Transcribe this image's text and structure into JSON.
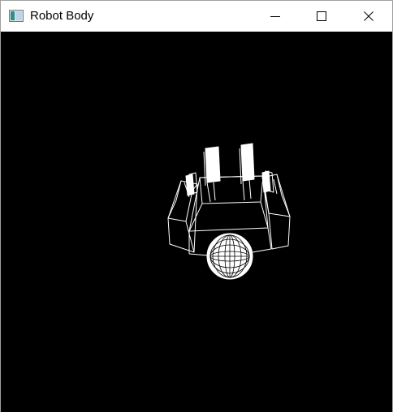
{
  "window": {
    "title": "Robot Body",
    "icon": "window-app-icon",
    "controls": {
      "minimize_icon": "minimize-icon",
      "maximize_icon": "maximize-icon",
      "close_icon": "close-icon"
    }
  },
  "scene": {
    "background": "#000000",
    "stroke_color": "#ffffff",
    "render_mode": "wireframe"
  }
}
